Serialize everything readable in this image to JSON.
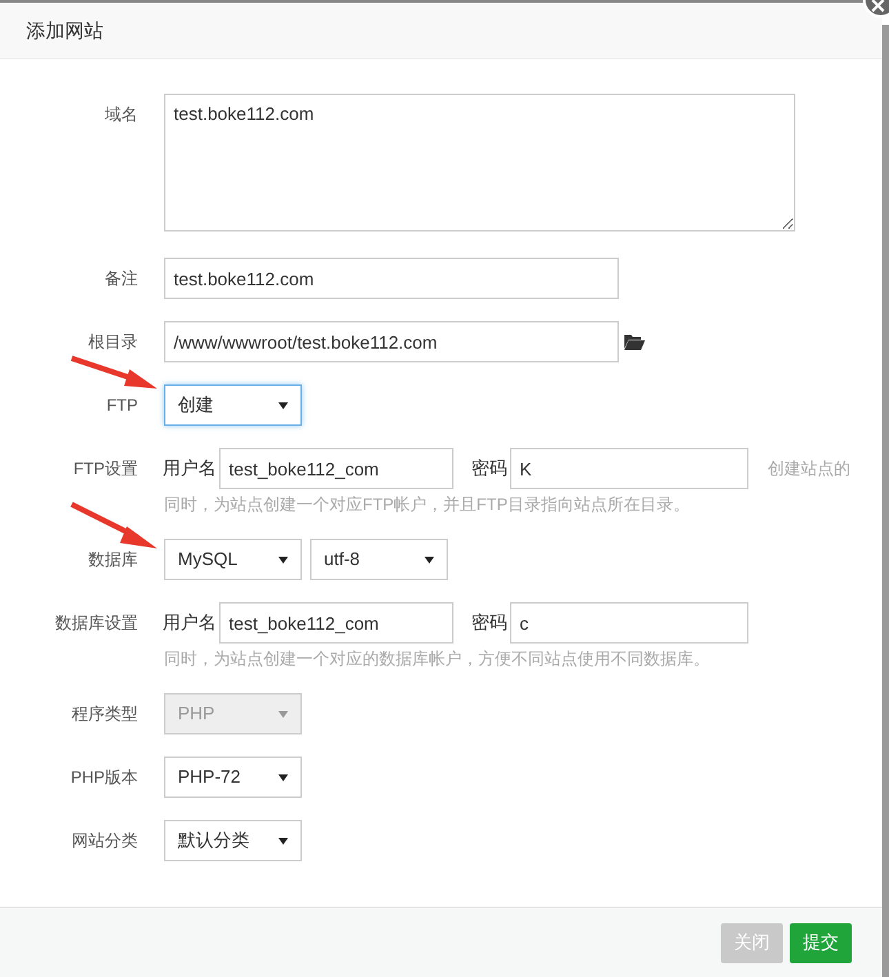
{
  "dialog": {
    "title": "添加网站"
  },
  "fields": [
    {
      "kind": "textarea",
      "label": "域名",
      "value": "test.boke112.com"
    },
    {
      "kind": "input",
      "label": "备注",
      "value": "test.boke112.com"
    },
    {
      "kind": "path",
      "label": "根目录",
      "value": "/www/wwwroot/test.boke112.com"
    },
    {
      "kind": "select",
      "label": "FTP",
      "selects": [
        {
          "value": "创建",
          "focused": true
        }
      ]
    },
    {
      "kind": "account",
      "label": "FTP设置",
      "user_label": "用户名",
      "user": "test_boke112_com",
      "pass_label": "密码",
      "pass": "K",
      "hint_start": "创建站点的",
      "hint": "同时，为站点创建一个对应FTP帐户，并且FTP目录指向站点所在目录。"
    },
    {
      "kind": "select",
      "label": "数据库",
      "selects": [
        {
          "value": "MySQL",
          "focused": false
        },
        {
          "value": "utf-8",
          "focused": false
        }
      ]
    },
    {
      "kind": "account",
      "label": "数据库设置",
      "user_label": "用户名",
      "user": "test_boke112_com",
      "pass_label": "密码",
      "pass": "c",
      "hint": "同时，为站点创建一个对应的数据库帐户，方便不同站点使用不同数据库。"
    },
    {
      "kind": "select",
      "label": "程序类型",
      "selects": [
        {
          "value": "PHP",
          "focused": false,
          "disabled": true
        }
      ]
    },
    {
      "kind": "select",
      "label": "PHP版本",
      "selects": [
        {
          "value": "PHP-72",
          "focused": false
        }
      ]
    },
    {
      "kind": "select",
      "label": "网站分类",
      "selects": [
        {
          "value": "默认分类",
          "focused": false
        }
      ]
    }
  ],
  "buttons": [
    {
      "label": "关闭",
      "kind": "secondary"
    },
    {
      "label": "提交",
      "kind": "primary"
    }
  ]
}
